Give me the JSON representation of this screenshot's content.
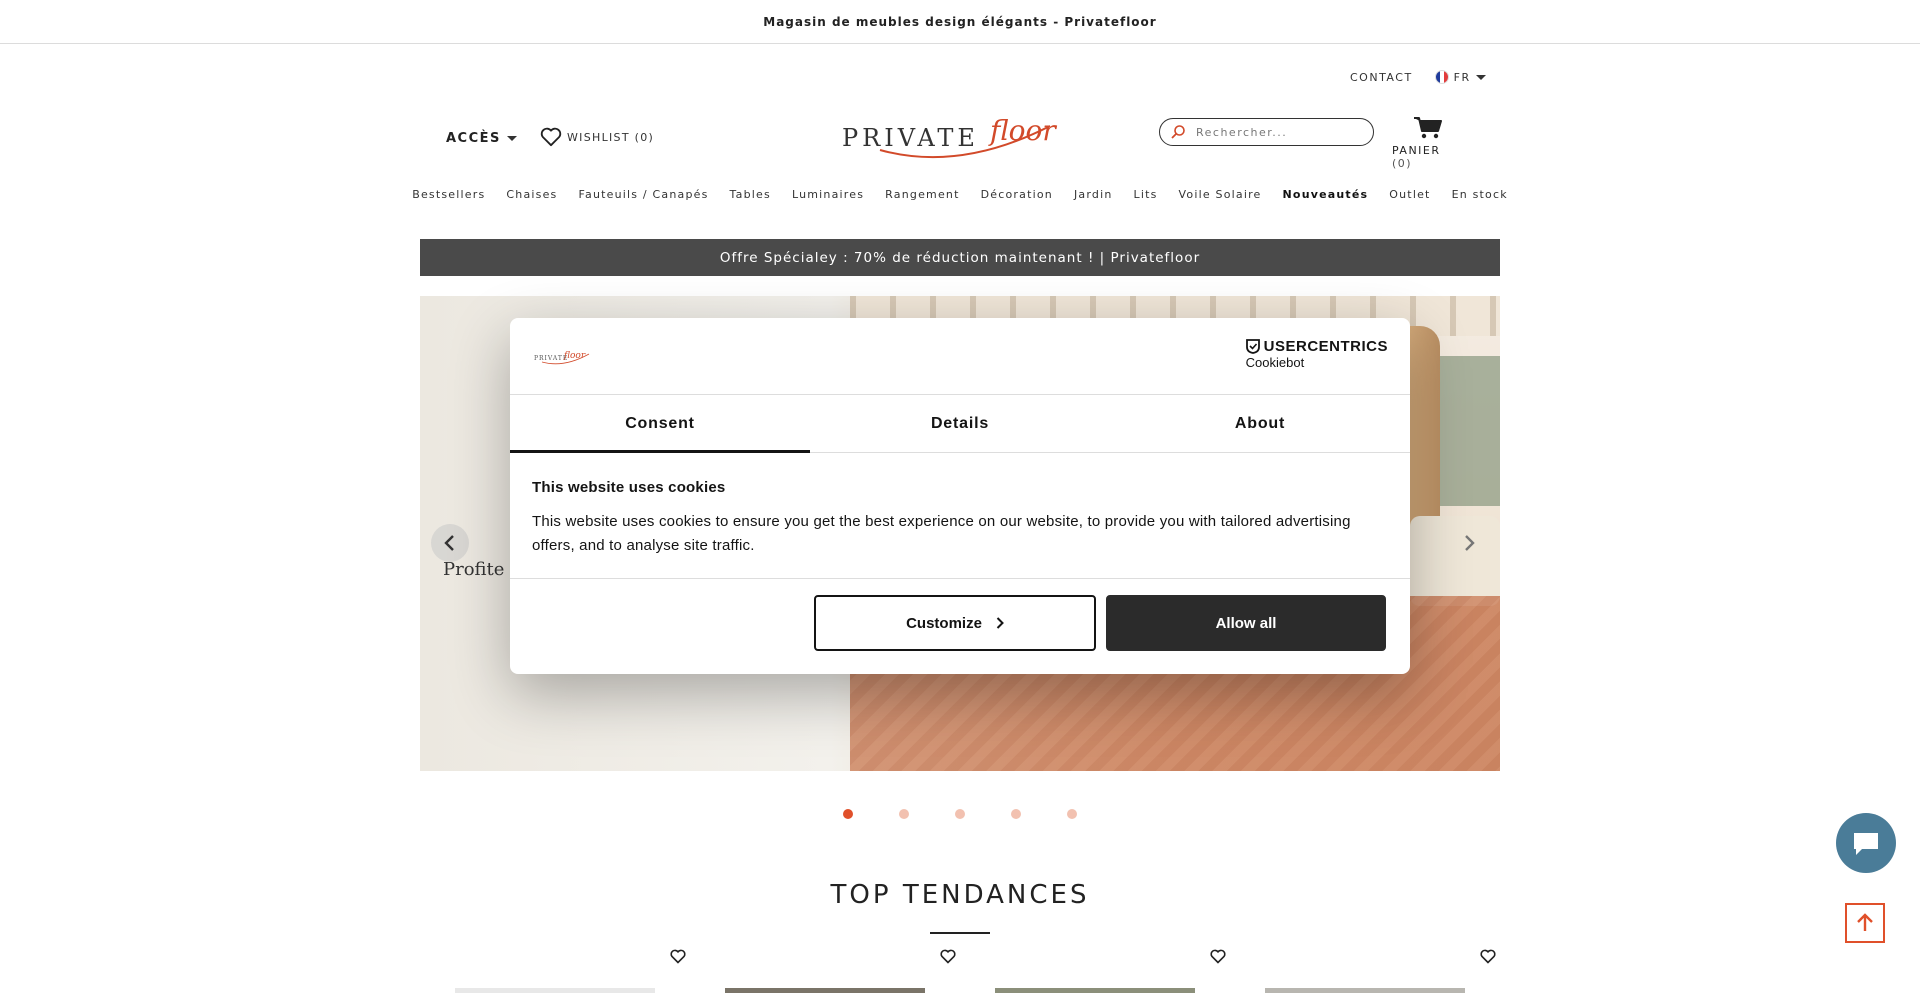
{
  "topbar": {
    "text": "Magasin de meubles design élégants - Privatefloor"
  },
  "utility": {
    "contact": "CONTACT",
    "lang": "FR"
  },
  "header": {
    "acces": "ACCÈS",
    "wishlist": "WISHLIST (0)",
    "search_placeholder": "Rechercher...",
    "cart_label": "PANIER",
    "cart_count": "(0)",
    "logo_text": "PRIVATEfloor"
  },
  "nav": {
    "items": [
      "Bestsellers",
      "Chaises",
      "Fauteuils / Canapés",
      "Tables",
      "Luminaires",
      "Rangement",
      "Décoration",
      "Jardin",
      "Lits",
      "Voile Solaire",
      "Nouveautés",
      "Outlet",
      "En stock"
    ],
    "bold_index": 10
  },
  "promo": {
    "text": "Offre Spécialey : 70% de réduction maintenant ! | Privatefloor"
  },
  "hero": {
    "partial_text": "Profite",
    "slides": 5,
    "active_slide": 1
  },
  "section": {
    "title": "TOP TENDANCES"
  },
  "cookie_dialog": {
    "brand_line1": "USERCENTRICS",
    "brand_line2": "Cookiebot",
    "tabs": [
      "Consent",
      "Details",
      "About"
    ],
    "active_tab": "Consent",
    "heading": "This website uses cookies",
    "body": "This website uses cookies to ensure you get the best experience on our website, to provide you with tailored advertising offers, and to analyse site traffic.",
    "customize_label": "Customize",
    "allow_label": "Allow all"
  },
  "colors": {
    "accent": "#e0502a",
    "promo_bg": "#4a4a4a",
    "chat_bg": "#4a7c98",
    "dialog_dark": "#2b2b2b"
  }
}
